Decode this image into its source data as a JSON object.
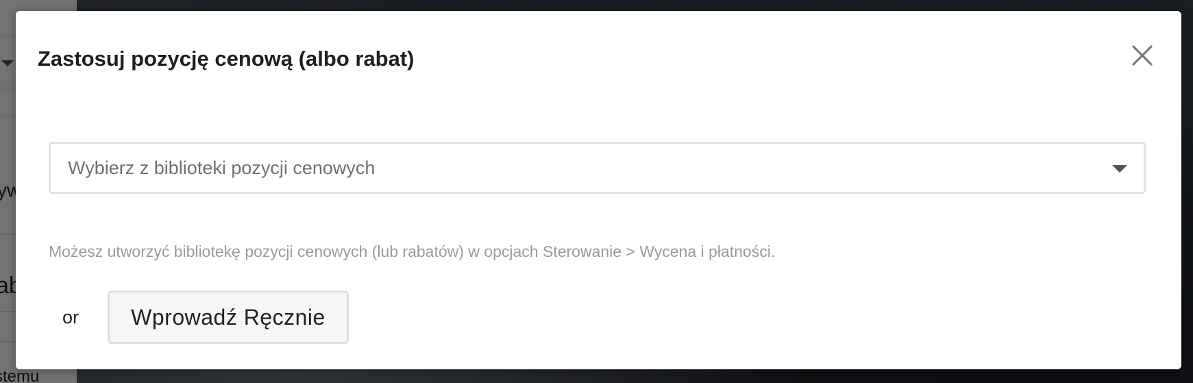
{
  "background": {
    "left_panel_fragments": [
      "ywe",
      "ab",
      "stemu"
    ]
  },
  "modal": {
    "title": "Zastosuj pozycję cenową (albo rabat)",
    "close_icon": "close-icon",
    "select": {
      "placeholder": "Wybierz z biblioteki pozycji cenowych",
      "caret_icon": "chevron-down-icon"
    },
    "hint": "Możesz utworzyć bibliotekę pozycji cenowych (lub rabatów) w opcjach Sterowanie > Wycena i płatności.",
    "or_label": "or",
    "manual_button_label": "Wprowadź Ręcznie"
  },
  "colors": {
    "overlay": "#000000",
    "modal_bg": "#ffffff",
    "title_text": "#1f1f1f",
    "hint_text": "#9a9a9a",
    "border": "#e1e1e1"
  }
}
